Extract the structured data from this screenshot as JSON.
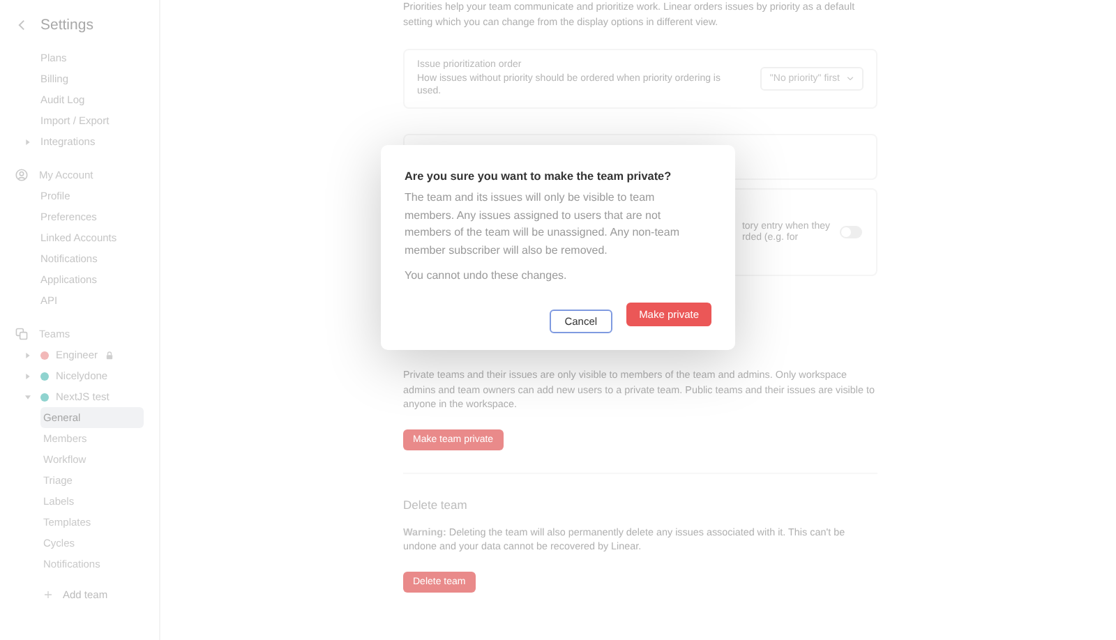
{
  "sidebar": {
    "title": "Settings",
    "workspace_items": [
      {
        "label": "Plans",
        "kind": "item",
        "selected": false
      },
      {
        "label": "Billing",
        "kind": "item",
        "selected": false
      },
      {
        "label": "Audit Log",
        "kind": "item",
        "selected": false
      },
      {
        "label": "Import / Export",
        "kind": "item",
        "selected": false
      },
      {
        "label": "Integrations",
        "kind": "group",
        "expanded": false,
        "selected": false
      }
    ],
    "account": {
      "label": "My Account",
      "items": [
        {
          "label": "Profile",
          "selected": false
        },
        {
          "label": "Preferences",
          "selected": false
        },
        {
          "label": "Linked Accounts",
          "selected": false
        },
        {
          "label": "Notifications",
          "selected": false
        },
        {
          "label": "Applications",
          "selected": false
        },
        {
          "label": "API",
          "selected": false
        }
      ]
    },
    "teams": {
      "label": "Teams",
      "items": [
        {
          "label": "Engineer",
          "color": "#f2b8b8",
          "locked": true,
          "expanded": false
        },
        {
          "label": "Nicelydone",
          "color": "#8fd3cf",
          "locked": false,
          "expanded": false
        },
        {
          "label": "NextJS test",
          "color": "#8fd3cf",
          "locked": false,
          "expanded": true,
          "children": [
            {
              "label": "General",
              "selected": true
            },
            {
              "label": "Members",
              "selected": false
            },
            {
              "label": "Workflow",
              "selected": false
            },
            {
              "label": "Triage",
              "selected": false
            },
            {
              "label": "Labels",
              "selected": false
            },
            {
              "label": "Templates",
              "selected": false
            },
            {
              "label": "Cycles",
              "selected": false
            },
            {
              "label": "Notifications",
              "selected": false
            }
          ]
        }
      ],
      "add_label": "Add team"
    }
  },
  "main": {
    "intro": "Priorities help your team communicate and prioritize work. Linear orders issues by priority as a default setting which you can change from the display options in different view.",
    "priority_card": {
      "title": "Issue prioritization order",
      "description": "How issues without priority should be ordered when priority ordering is used.",
      "select_value": "\"No priority\" first"
    },
    "partial_card": {
      "lines": [
        "tory entry when they",
        "rded (e.g. for"
      ],
      "toggle_on": false
    },
    "private_description": "Private teams and their issues are only visible to members of the team and admins. Only workspace admins and team owners can add new users to a private team. Public teams and their issues are visible to anyone in the workspace.",
    "private_button": "Make team private",
    "delete_title": "Delete team",
    "delete_warning": "**Warning:** Deleting the team will also permanently delete any issues associated with it. This can't be undone and your data cannot be recovered by Linear.",
    "delete_button": "Delete team"
  },
  "dialog": {
    "title": "Are you sure you want to make the team private?",
    "body": "The team and its issues will only be visible to team members. Any issues assigned to users that are not members of the team will be unassigned. Any non-team member subscriber will also be removed.",
    "note": "You cannot undo these changes.",
    "buttons": [
      {
        "label": "Cancel",
        "kind": "secondary"
      },
      {
        "label": "Make private",
        "kind": "danger"
      }
    ]
  }
}
